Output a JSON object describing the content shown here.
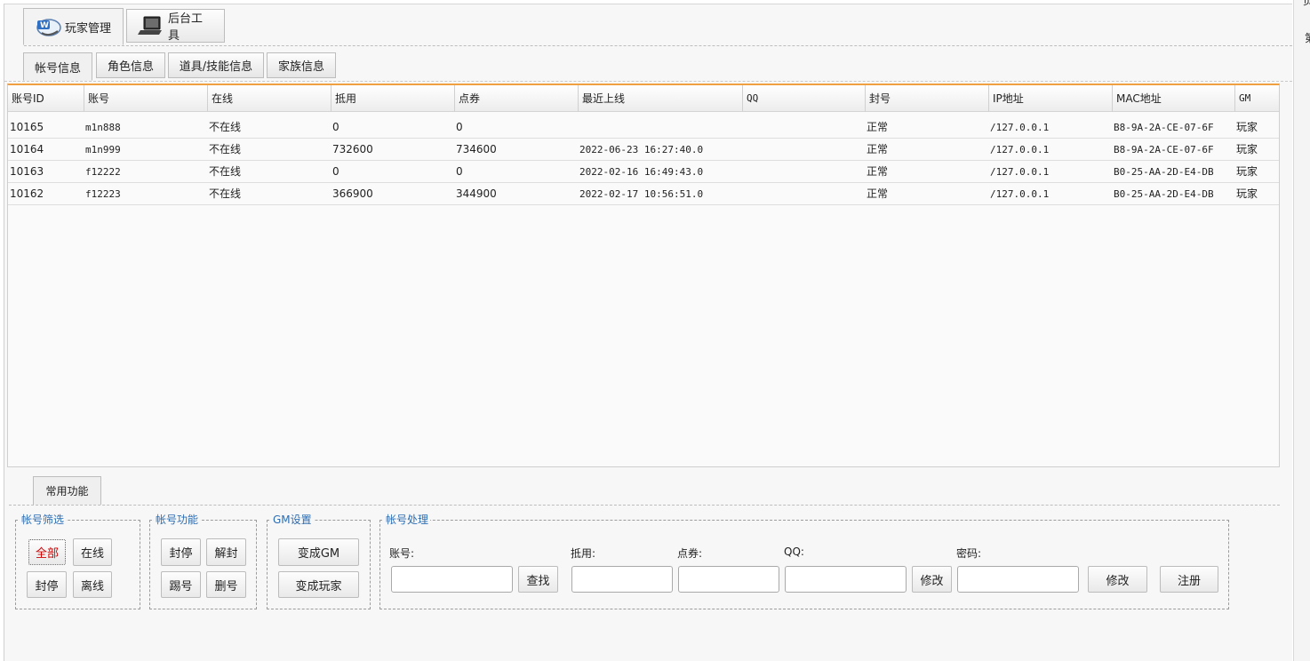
{
  "top_tabs": [
    {
      "label": "玩家管理",
      "icon": "player-window-icon"
    },
    {
      "label": "后台工具",
      "icon": "laptop-icon"
    }
  ],
  "sub_tabs": [
    "帐号信息",
    "角色信息",
    "道具/技能信息",
    "家族信息"
  ],
  "table": {
    "columns": [
      "账号ID",
      "账号",
      "在线",
      "抵用",
      "点券",
      "最近上线",
      "QQ",
      "封号",
      "IP地址",
      "MAC地址",
      "GM"
    ],
    "rows": [
      [
        "10165",
        "m1n888",
        "不在线",
        "0",
        "0",
        "",
        "",
        "正常",
        "/127.0.0.1",
        "B8-9A-2A-CE-07-6F",
        "玩家"
      ],
      [
        "10164",
        "m1n999",
        "不在线",
        "732600",
        "734600",
        "2022-06-23 16:27:40.0",
        "",
        "正常",
        "/127.0.0.1",
        "B8-9A-2A-CE-07-6F",
        "玩家"
      ],
      [
        "10163",
        "f12222",
        "不在线",
        "0",
        "0",
        "2022-02-16 16:49:43.0",
        "",
        "正常",
        "/127.0.0.1",
        "B0-25-AA-2D-E4-DB",
        "玩家"
      ],
      [
        "10162",
        "f12223",
        "不在线",
        "366900",
        "344900",
        "2022-02-17 10:56:51.0",
        "",
        "正常",
        "/127.0.0.1",
        "B0-25-AA-2D-E4-DB",
        "玩家"
      ]
    ]
  },
  "bottom": {
    "tab": "常用功能",
    "filter": {
      "legend": "帐号筛选",
      "all": "全部",
      "online": "在线",
      "banned": "封停",
      "offline": "离线"
    },
    "account_func": {
      "legend": "帐号功能",
      "ban": "封停",
      "unban": "解封",
      "kick": "踢号",
      "delete": "删号"
    },
    "gm": {
      "legend": "GM设置",
      "make_gm": "变成GM",
      "make_player": "变成玩家"
    },
    "process": {
      "legend": "帐号处理",
      "account_label": "账号:",
      "coupon_label": "抵用:",
      "points_label": "点券:",
      "qq_label": "QQ:",
      "password_label": "密码:",
      "search": "查找",
      "modify_qq": "修改",
      "modify": "修改",
      "register": "注册",
      "account_value": "",
      "coupon_value": "",
      "points_value": "",
      "qq_value": "",
      "password_value": ""
    }
  },
  "right_strip": {
    "top_text": "页",
    "mid_text": "第"
  },
  "colors": {
    "accent_orange": "#f0a040",
    "legend_blue": "#2b6db3",
    "selected_red": "#d00000"
  }
}
